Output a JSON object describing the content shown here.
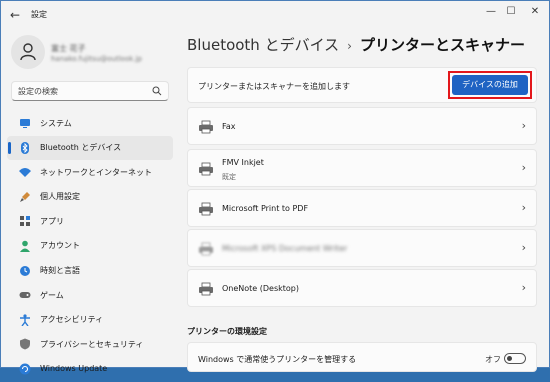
{
  "window": {
    "title": "設定",
    "back_glyph": "←",
    "min_glyph": "—",
    "max_glyph": "☐",
    "close_glyph": "✕"
  },
  "profile": {
    "name": "富士 花子",
    "email": "hanako.fujitsu@outlook.jp"
  },
  "search": {
    "placeholder": "設定の検索"
  },
  "sidebar": {
    "items": [
      {
        "label": "システム",
        "icon": "monitor-icon"
      },
      {
        "label": "Bluetooth とデバイス",
        "icon": "bluetooth-icon",
        "active": true
      },
      {
        "label": "ネットワークとインターネット",
        "icon": "wifi-icon"
      },
      {
        "label": "個人用設定",
        "icon": "brush-icon"
      },
      {
        "label": "アプリ",
        "icon": "apps-icon"
      },
      {
        "label": "アカウント",
        "icon": "person-icon"
      },
      {
        "label": "時刻と言語",
        "icon": "globe-clock-icon"
      },
      {
        "label": "ゲーム",
        "icon": "gamepad-icon"
      },
      {
        "label": "アクセシビリティ",
        "icon": "accessibility-icon"
      },
      {
        "label": "プライバシーとセキュリティ",
        "icon": "shield-icon"
      },
      {
        "label": "Windows Update",
        "icon": "update-icon"
      }
    ]
  },
  "breadcrumb": {
    "parent": "Bluetooth とデバイス",
    "separator": "›",
    "current": "プリンターとスキャナー"
  },
  "add_printer": {
    "text": "プリンターまたはスキャナーを追加します",
    "button_label": "デバイスの追加"
  },
  "devices": [
    {
      "name": "Fax",
      "sub": ""
    },
    {
      "name": "FMV Inkjet",
      "sub": "既定"
    },
    {
      "name": "Microsoft Print to PDF",
      "sub": ""
    },
    {
      "name": "Microsoft XPS Document Writer",
      "sub": ""
    },
    {
      "name": "OneNote (Desktop)",
      "sub": ""
    }
  ],
  "chevron": "›",
  "printer_settings": {
    "section_title": "プリンターの環境設定",
    "manage_default_label": "Windows で通常使うプリンターを管理する",
    "manage_default_state": "オフ"
  },
  "colors": {
    "accent": "#1f63c3",
    "highlight": "#e3171b",
    "background": "#f3f3f3"
  }
}
